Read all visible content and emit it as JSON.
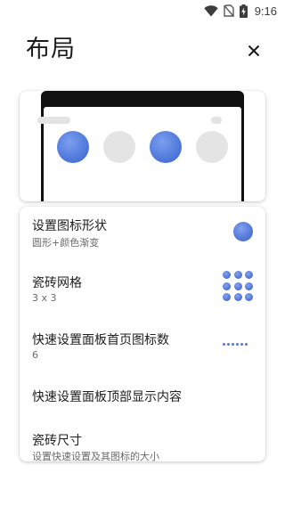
{
  "status_bar": {
    "time": "9:16",
    "icons": [
      "wifi-icon",
      "no-sim-icon",
      "battery-charging-icon"
    ]
  },
  "header": {
    "title": "布局",
    "close_icon": "close-icon"
  },
  "preview": {
    "tiles": [
      {
        "state": "on"
      },
      {
        "state": "off"
      },
      {
        "state": "on"
      },
      {
        "state": "off"
      }
    ]
  },
  "settings": [
    {
      "title": "设置图标形状",
      "subtitle": "圆形+颜色渐变",
      "icon": "circle-shape-icon"
    },
    {
      "title": "瓷砖网格",
      "subtitle": "3 x 3",
      "icon": "grid-icon"
    },
    {
      "title": "快速设置面板首页图标数",
      "subtitle": "6",
      "icon": "dots-icon"
    },
    {
      "title": "快速设置面板顶部显示内容",
      "subtitle": "",
      "icon": ""
    },
    {
      "title": "瓷砖尺寸",
      "subtitle": "设置快速设置及其图标的大小",
      "icon": ""
    }
  ],
  "colors": {
    "accent": "#4f79db",
    "tile_off": "#e4e4e4",
    "text_primary": "#202020",
    "text_secondary": "#6a6a6a"
  }
}
